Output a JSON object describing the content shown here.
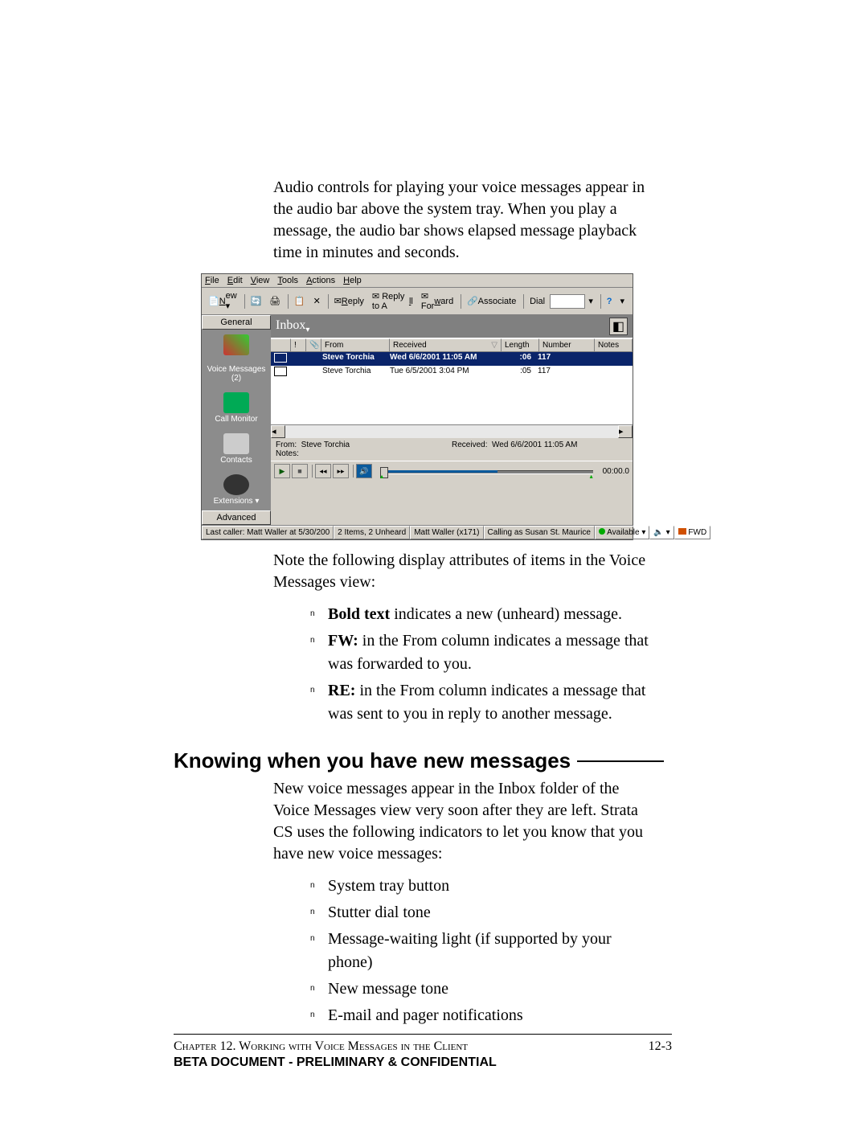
{
  "intro_paragraph": "Audio controls for playing your voice messages appear in the audio bar above the system tray. When you play a message, the audio bar shows elapsed message playback time in minutes and seconds.",
  "screenshot": {
    "menu": {
      "file": "File",
      "edit": "Edit",
      "view": "View",
      "tools": "Tools",
      "actions": "Actions",
      "help": "Help"
    },
    "toolbar": {
      "new": "New",
      "reply": "Reply",
      "reply_all": "Reply to All",
      "forward": "Forward",
      "associate": "Associate",
      "dial": "Dial"
    },
    "sidebar": {
      "header": "General",
      "items": [
        {
          "label": ""
        },
        {
          "label": "Voice Messages (2)"
        },
        {
          "label": "Call Monitor"
        },
        {
          "label": "Contacts"
        },
        {
          "label": "Extensions"
        }
      ],
      "footer": "Advanced"
    },
    "folder_title": "Inbox",
    "columns": {
      "from": "From",
      "received": "Received",
      "length": "Length",
      "number": "Number",
      "notes": "Notes"
    },
    "rows": [
      {
        "from": "Steve Torchia",
        "received": "Wed 6/6/2001 11:05 AM",
        "length": ":06",
        "number": "117",
        "bold": true,
        "selected": true
      },
      {
        "from": "Steve Torchia",
        "received": "Tue 6/5/2001 3:04 PM",
        "length": ":05",
        "number": "117",
        "bold": false,
        "selected": false
      }
    ],
    "detail": {
      "from_label": "From:",
      "from_value": "Steve Torchia",
      "recv_label": "Received:",
      "recv_value": "Wed 6/6/2001 11:05 AM",
      "notes_label": "Notes:"
    },
    "audio_time": "00:00.0",
    "status": {
      "last_caller": "Last caller: Matt Waller at 5/30/200",
      "items": "2 Items, 2 Unheard",
      "ext": "Matt Waller (x171)",
      "calling_as": "Calling as Susan St. Maurice",
      "availability": "Available",
      "fwd": "FWD"
    }
  },
  "note_intro": "Note the following display attributes of items in the Voice Messages view:",
  "bullets1": {
    "b1_strong": "Bold text",
    "b1_rest": " indicates a new (unheard) message.",
    "b2_strong": "FW:",
    "b2_rest": " in the From column indicates a message that was forwarded to you.",
    "b3_strong": "RE:",
    "b3_rest": " in the From column indicates a message that was sent to you in reply to another message."
  },
  "heading": "Knowing when you have new messages",
  "paragraph2": "New voice messages appear in the Inbox folder of the Voice Messages view very soon after they are left. Strata CS uses the following indicators to let you know that you have new voice messages:",
  "bullets2": [
    "System tray button",
    "Stutter dial tone",
    "Message-waiting light (if supported by your phone)",
    "New message tone",
    "E-mail and pager notifications"
  ],
  "footer": {
    "chapter": "Chapter 12. Working with Voice Messages in the Client",
    "page_num": "12-3",
    "confidential": "BETA DOCUMENT - PRELIMINARY & CONFIDENTIAL"
  }
}
